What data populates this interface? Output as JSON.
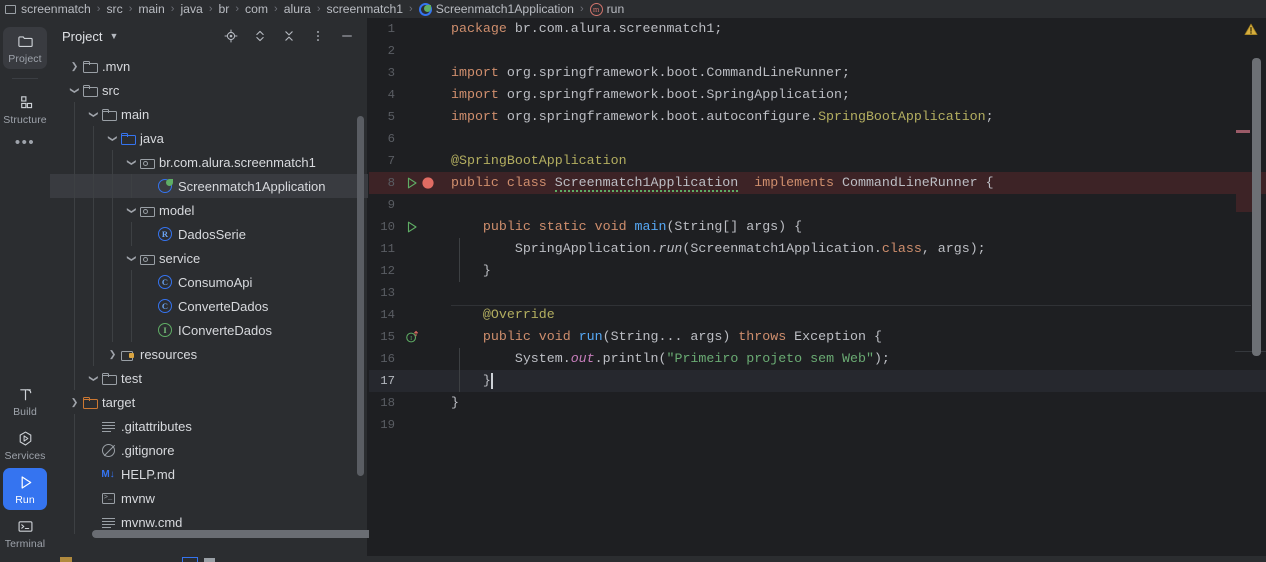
{
  "breadcrumb": {
    "items": [
      {
        "label": "screenmatch",
        "icon": "module-icon"
      },
      {
        "label": "src",
        "icon": null
      },
      {
        "label": "main",
        "icon": null
      },
      {
        "label": "java",
        "icon": null
      },
      {
        "label": "br",
        "icon": null
      },
      {
        "label": "com",
        "icon": null
      },
      {
        "label": "alura",
        "icon": null
      },
      {
        "label": "screenmatch1",
        "icon": null
      },
      {
        "label": "Screenmatch1Application",
        "icon": "spring-class-icon"
      },
      {
        "label": "run",
        "icon": "method-icon"
      }
    ],
    "separator": "›"
  },
  "tool_windows": [
    {
      "id": "project",
      "label": "Project",
      "icon": "folder-icon",
      "state": "active"
    },
    {
      "id": "structure",
      "label": "Structure",
      "icon": "structure-icon",
      "state": "normal"
    },
    {
      "id": "more",
      "label": "…",
      "icon": "more-dots-icon",
      "state": "normal"
    },
    {
      "id": "build",
      "label": "Build",
      "icon": "hammer-icon",
      "state": "normal"
    },
    {
      "id": "services",
      "label": "Services",
      "icon": "services-icon",
      "state": "normal"
    },
    {
      "id": "run",
      "label": "Run",
      "icon": "play-icon",
      "state": "accent"
    },
    {
      "id": "terminal",
      "label": "Terminal",
      "icon": "terminal-icon",
      "state": "normal"
    }
  ],
  "project_panel": {
    "title": "Project",
    "chevron": "⌄",
    "actions": [
      {
        "id": "select-opened-file",
        "name": "locate-icon"
      },
      {
        "id": "expand-collapse",
        "name": "expand-collapse-icon"
      },
      {
        "id": "collapse-all",
        "name": "collapse-all-icon"
      },
      {
        "id": "options",
        "name": "more-vertical-icon"
      },
      {
        "id": "hide",
        "name": "minimize-icon"
      }
    ],
    "tree": [
      {
        "label": ".mvn",
        "indent": 1,
        "arrow": "collapsed",
        "icon": "folder",
        "selected": false
      },
      {
        "label": "src",
        "indent": 1,
        "arrow": "expanded",
        "icon": "folder",
        "selected": false
      },
      {
        "label": "main",
        "indent": 2,
        "arrow": "expanded",
        "icon": "folder",
        "selected": false
      },
      {
        "label": "java",
        "indent": 3,
        "arrow": "expanded",
        "icon": "folder-blue",
        "selected": false
      },
      {
        "label": "br.com.alura.screenmatch1",
        "indent": 4,
        "arrow": "expanded",
        "icon": "package",
        "selected": false
      },
      {
        "label": "Screenmatch1Application",
        "indent": 5,
        "arrow": "none",
        "icon": "spring-class",
        "selected": true
      },
      {
        "label": "model",
        "indent": 4,
        "arrow": "expanded",
        "icon": "package",
        "selected": false
      },
      {
        "label": "DadosSerie",
        "indent": 5,
        "arrow": "none",
        "icon": "record",
        "selected": false
      },
      {
        "label": "service",
        "indent": 4,
        "arrow": "expanded",
        "icon": "package",
        "selected": false
      },
      {
        "label": "ConsumoApi",
        "indent": 5,
        "arrow": "none",
        "icon": "class",
        "selected": false
      },
      {
        "label": "ConverteDados",
        "indent": 5,
        "arrow": "none",
        "icon": "class",
        "selected": false
      },
      {
        "label": "IConverteDados",
        "indent": 5,
        "arrow": "none",
        "icon": "interface",
        "selected": false
      },
      {
        "label": "resources",
        "indent": 3,
        "arrow": "collapsed",
        "icon": "resources",
        "selected": false
      },
      {
        "label": "test",
        "indent": 2,
        "arrow": "expanded",
        "icon": "folder",
        "selected": false
      },
      {
        "label": "target",
        "indent": 1,
        "arrow": "collapsed",
        "icon": "folder-orange",
        "selected": false
      },
      {
        "label": ".gitattributes",
        "indent": 2,
        "arrow": "none",
        "icon": "text-file",
        "selected": false
      },
      {
        "label": ".gitignore",
        "indent": 2,
        "arrow": "none",
        "icon": "gitignore",
        "selected": false
      },
      {
        "label": "HELP.md",
        "indent": 2,
        "arrow": "none",
        "icon": "markdown",
        "selected": false
      },
      {
        "label": "mvnw",
        "indent": 2,
        "arrow": "none",
        "icon": "shell",
        "selected": false
      },
      {
        "label": "mvnw.cmd",
        "indent": 2,
        "arrow": "none",
        "icon": "text-file",
        "selected": false
      }
    ]
  },
  "editor": {
    "file": "Screenmatch1Application.java",
    "caret_line": 17,
    "breakpoint_line": 8,
    "warning_icon": "warning-triangle-icon",
    "lines": [
      {
        "n": 1,
        "tokens": [
          {
            "t": "package",
            "c": "kw"
          },
          {
            "t": " br.com.alura.screenmatch1;",
            "c": "pln"
          }
        ]
      },
      {
        "n": 2,
        "tokens": []
      },
      {
        "n": 3,
        "tokens": [
          {
            "t": "import",
            "c": "kw"
          },
          {
            "t": " org.springframework.boot.CommandLineRunner;",
            "c": "pln"
          }
        ]
      },
      {
        "n": 4,
        "tokens": [
          {
            "t": "import",
            "c": "kw"
          },
          {
            "t": " org.springframework.boot.SpringApplication;",
            "c": "pln"
          }
        ]
      },
      {
        "n": 5,
        "tokens": [
          {
            "t": "import",
            "c": "kw"
          },
          {
            "t": " org.springframework.boot.autoconfigure.",
            "c": "pln"
          },
          {
            "t": "SpringBootApplication",
            "c": "anno"
          },
          {
            "t": ";",
            "c": "pln"
          }
        ]
      },
      {
        "n": 6,
        "tokens": []
      },
      {
        "n": 7,
        "tokens": [
          {
            "t": "@SpringBootApplication",
            "c": "anno"
          }
        ]
      },
      {
        "n": 8,
        "tokens": [
          {
            "t": "public class ",
            "c": "kw"
          },
          {
            "t": "Screenmatch1Application",
            "c": "typ warnline"
          },
          {
            "t": "  ",
            "c": "pln"
          },
          {
            "t": "implements",
            "c": "kw"
          },
          {
            "t": " CommandLineRunner {",
            "c": "pln"
          }
        ]
      },
      {
        "n": 9,
        "tokens": []
      },
      {
        "n": 10,
        "tokens": [
          {
            "t": "    ",
            "c": "pln"
          },
          {
            "t": "public static void ",
            "c": "kw"
          },
          {
            "t": "main",
            "c": "fn"
          },
          {
            "t": "(String[] args) {",
            "c": "pln"
          }
        ]
      },
      {
        "n": 11,
        "tokens": [
          {
            "t": "        SpringApplication.",
            "c": "pln"
          },
          {
            "t": "run",
            "c": "mth-it"
          },
          {
            "t": "(Screenmatch1Application.",
            "c": "pln"
          },
          {
            "t": "class",
            "c": "kw"
          },
          {
            "t": ", args);",
            "c": "pln"
          }
        ]
      },
      {
        "n": 12,
        "tokens": [
          {
            "t": "    }",
            "c": "pln"
          }
        ]
      },
      {
        "n": 13,
        "tokens": []
      },
      {
        "n": 14,
        "tokens": [
          {
            "t": "    ",
            "c": "pln"
          },
          {
            "t": "@Override",
            "c": "anno"
          }
        ]
      },
      {
        "n": 15,
        "tokens": [
          {
            "t": "    ",
            "c": "pln"
          },
          {
            "t": "public void ",
            "c": "kw"
          },
          {
            "t": "run",
            "c": "fn"
          },
          {
            "t": "(String... args) ",
            "c": "pln"
          },
          {
            "t": "throws",
            "c": "kw"
          },
          {
            "t": " Exception {",
            "c": "pln"
          }
        ]
      },
      {
        "n": 16,
        "tokens": [
          {
            "t": "        System.",
            "c": "pln"
          },
          {
            "t": "out",
            "c": "fld"
          },
          {
            "t": ".println(",
            "c": "pln"
          },
          {
            "t": "\"Primeiro projeto sem Web\"",
            "c": "str"
          },
          {
            "t": ");",
            "c": "pln"
          }
        ]
      },
      {
        "n": 17,
        "tokens": [
          {
            "t": "    }",
            "c": "pln"
          }
        ]
      },
      {
        "n": 18,
        "tokens": [
          {
            "t": "}",
            "c": "pln"
          }
        ]
      },
      {
        "n": 19,
        "tokens": []
      }
    ],
    "gutter_icons": [
      {
        "line": 8,
        "name": "run-class-icon",
        "kind": "run-triangle"
      },
      {
        "line": 8,
        "name": "breakpoint-icon",
        "kind": "breakpoint"
      },
      {
        "line": 10,
        "name": "run-main-icon",
        "kind": "run-triangle"
      },
      {
        "line": 15,
        "name": "implements-method-icon",
        "kind": "implements"
      }
    ]
  }
}
